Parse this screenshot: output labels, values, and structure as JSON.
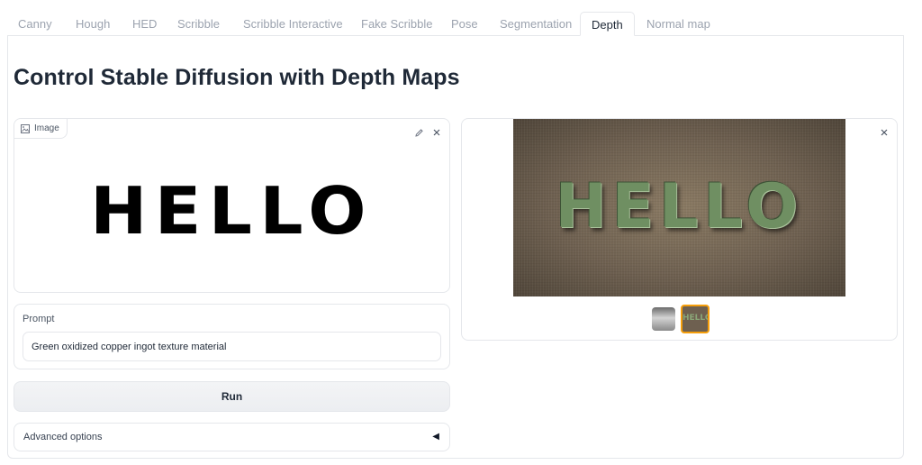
{
  "tabs": [
    "Canny",
    "Hough",
    "HED",
    "Scribble",
    "Scribble Interactive",
    "Fake Scribble",
    "Pose",
    "Segmentation",
    "Depth",
    "Normal map"
  ],
  "active_tab": "Depth",
  "title": "Control Stable Diffusion with Depth Maps",
  "image_input": {
    "label": "Image",
    "content_text": "HELLO"
  },
  "prompt": {
    "label": "Prompt",
    "value": "Green oxidized copper ingot texture material"
  },
  "run_label": "Run",
  "advanced": {
    "label": "Advanced options",
    "caret": "◀"
  },
  "gallery": {
    "image_text": "HELLO",
    "thumb_text": "HELLO"
  }
}
